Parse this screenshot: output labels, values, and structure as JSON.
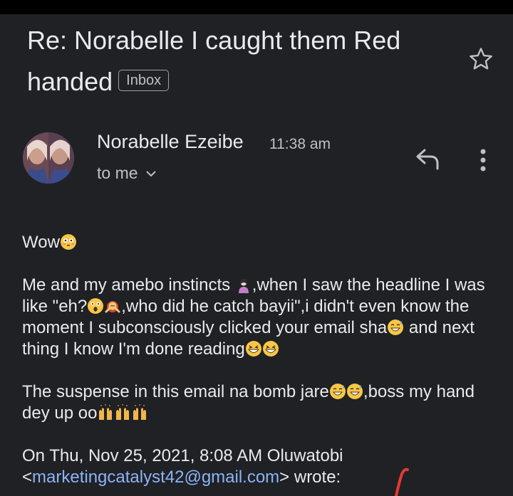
{
  "subject": {
    "line1": "Re: Norabelle I caught them Red",
    "line2": "handed",
    "label": "Inbox"
  },
  "icons": {
    "star": "star-icon",
    "reply": "reply-icon",
    "more": "more-vert-icon",
    "chevron": "chevron-down-icon"
  },
  "sender": {
    "name": "Norabelle Ezeibe",
    "time": "11:38 am",
    "recipient": "to me"
  },
  "body": {
    "p1": "Wow",
    "p2a": "Me and my amebo instincts ",
    "p2b": ",when I saw the headline I was like \"eh?",
    "p2c": ",who did he catch bayii\",i didn't even know the moment I subconsciously clicked your email sha",
    "p2d": " and next thing I know I'm done reading",
    "p3a": "The suspense in this email na bomb jare",
    "p3b": ",boss my hand dey up oo",
    "quote_prefix": "On Thu, Nov 25, 2021, 8:08 AM Oluwatobi",
    "quote_email": "marketingcatalyst42@gmail.com",
    "quote_suffix": " wrote:"
  },
  "colors": {
    "background": "#202124",
    "link": "#8ab4f8",
    "annotation_mark": "#e53935"
  }
}
